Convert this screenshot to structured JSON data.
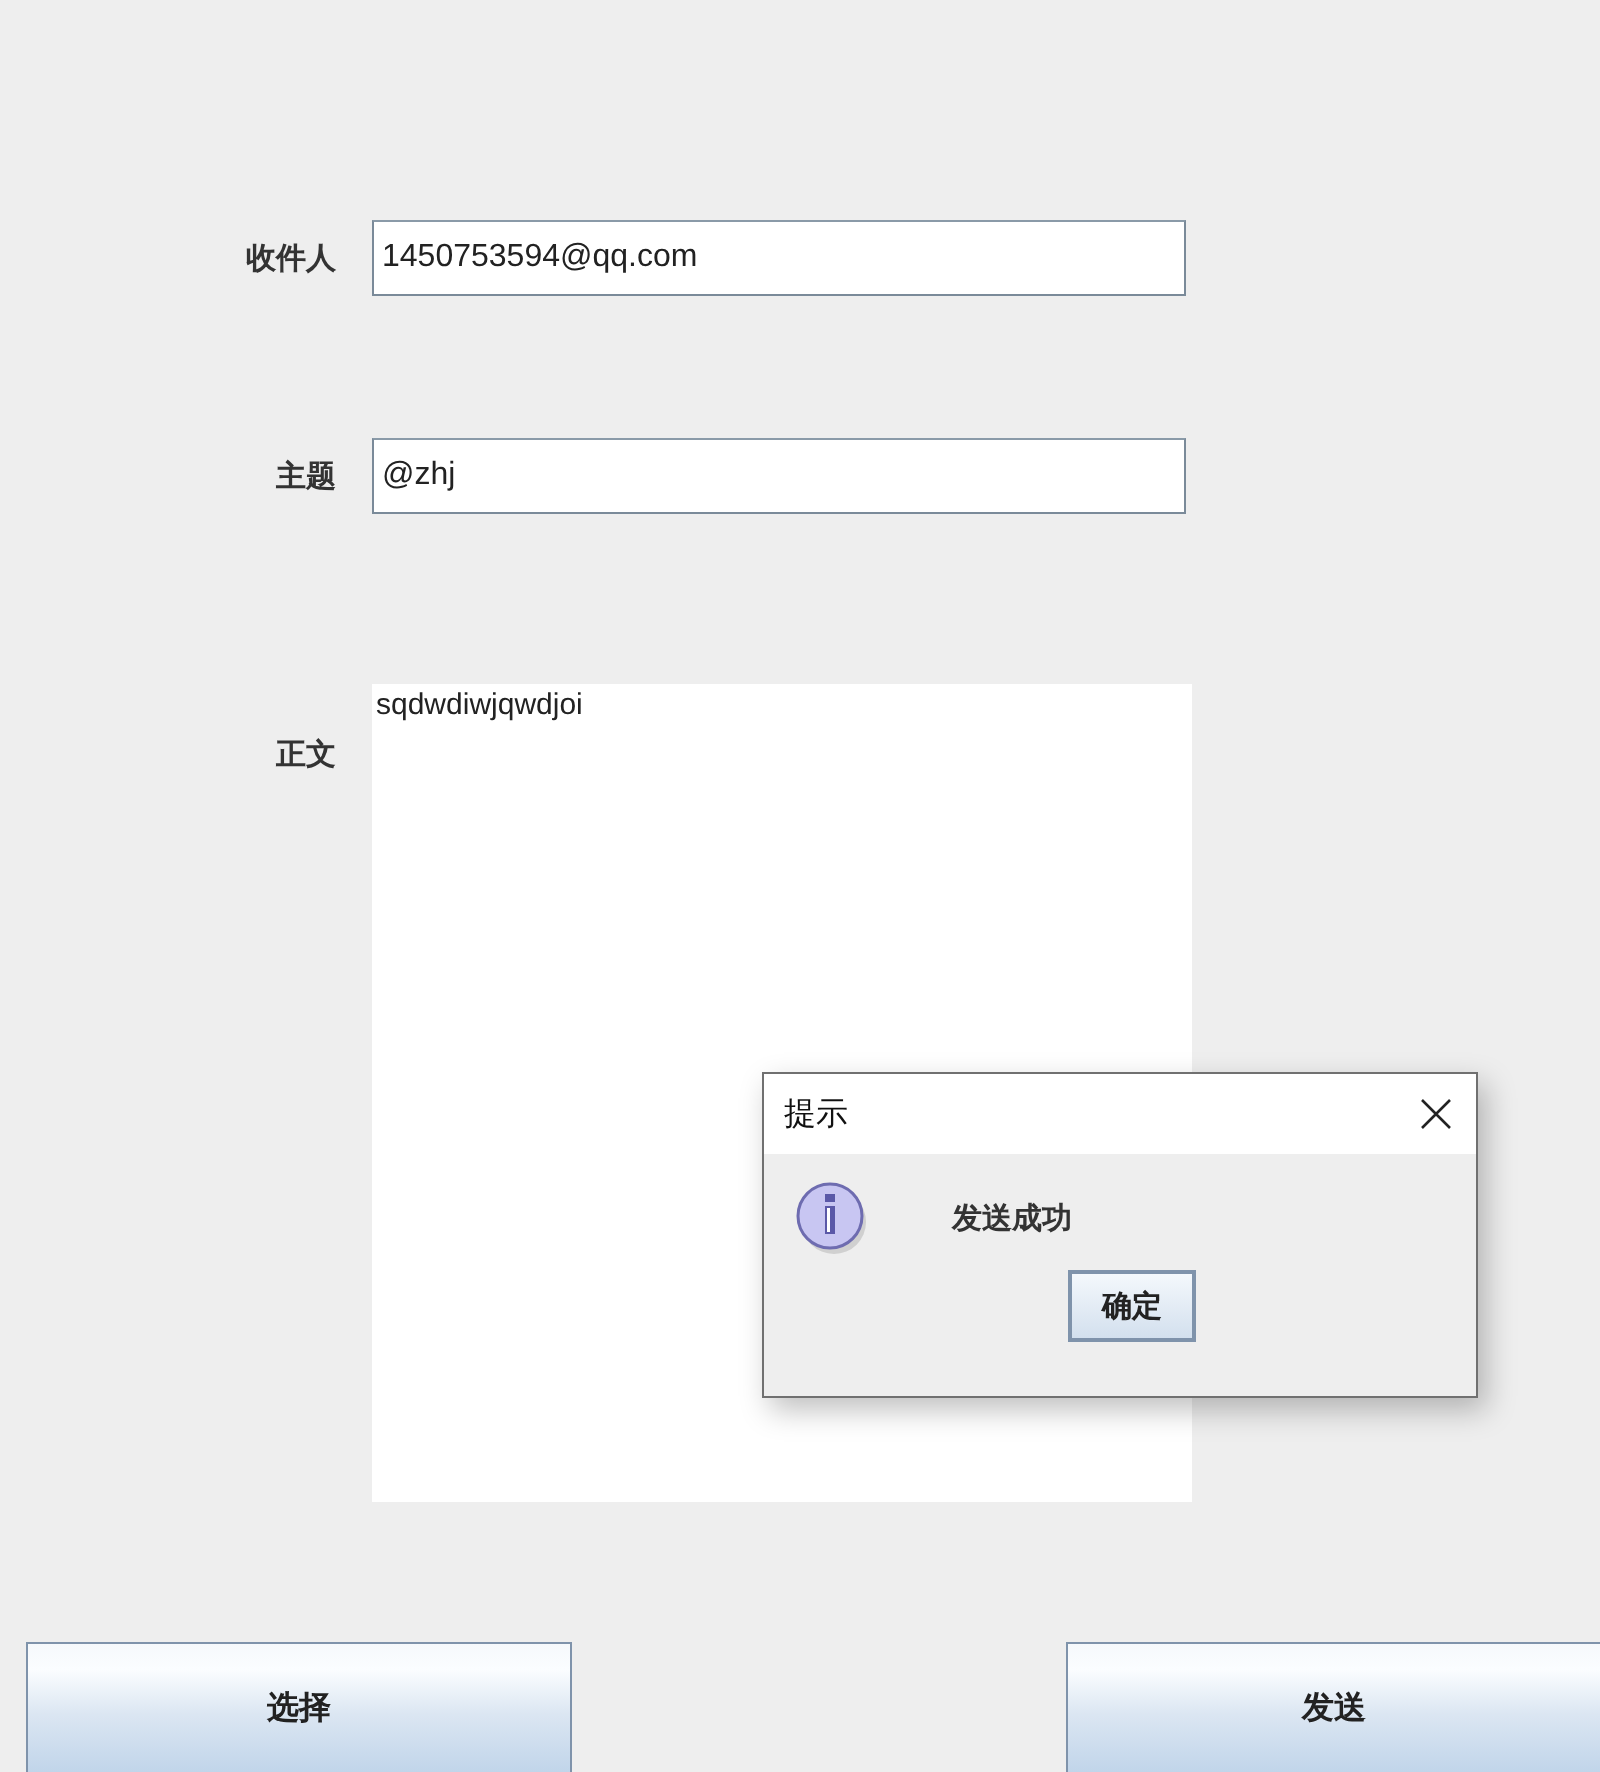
{
  "form": {
    "fields": [
      {
        "label": "收件人",
        "value": "1450753594@qq.com"
      },
      {
        "label": "主题",
        "value": "@zhj"
      }
    ],
    "body": {
      "label": "正文",
      "value": "sqdwdiwjqwdjoi"
    }
  },
  "buttons": [
    {
      "label": "选择"
    },
    {
      "label": "发送"
    }
  ],
  "dialog": {
    "title": "提示",
    "message": "发送成功",
    "button": "确定"
  }
}
